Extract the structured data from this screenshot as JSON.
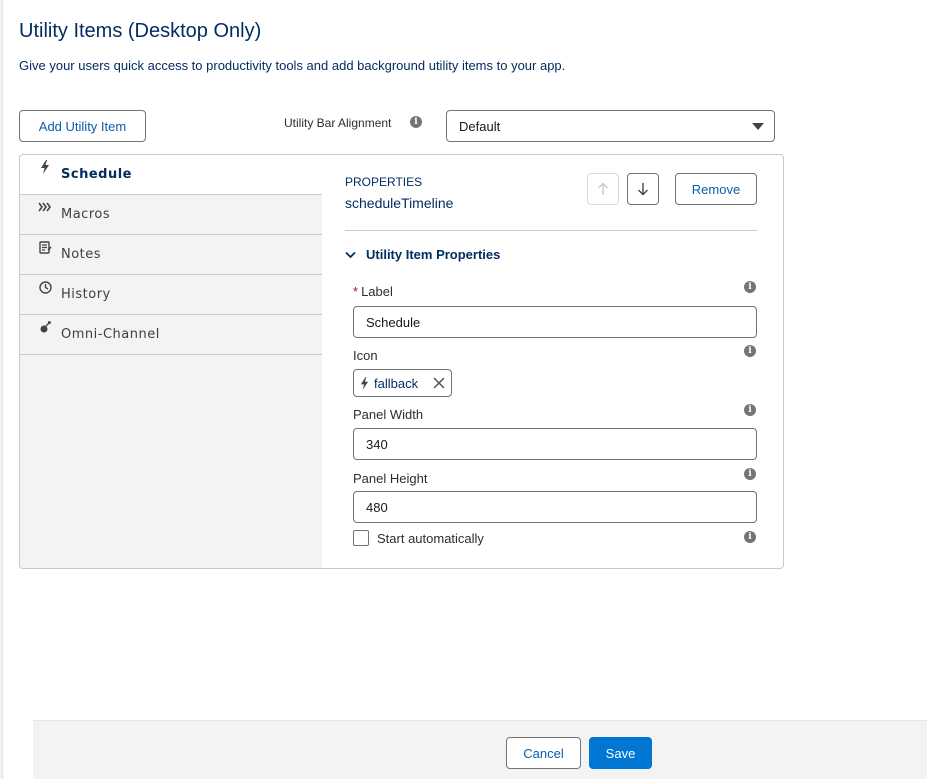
{
  "page": {
    "title": "Utility Items (Desktop Only)",
    "description": "Give your users quick access to productivity tools and add background utility items to your app."
  },
  "toolbar": {
    "add_label": "Add Utility Item",
    "alignment_label": "Utility Bar Alignment",
    "alignment_value": "Default"
  },
  "sidebar": {
    "items": [
      {
        "label": "Schedule",
        "icon": "lightning-icon",
        "active": true
      },
      {
        "label": "Macros",
        "icon": "macros-icon",
        "active": false
      },
      {
        "label": "Notes",
        "icon": "notes-icon",
        "active": false
      },
      {
        "label": "History",
        "icon": "clock-icon",
        "active": false
      },
      {
        "label": "Omni-Channel",
        "icon": "omni-channel-icon",
        "active": false
      }
    ]
  },
  "properties": {
    "caps_label": "PROPERTIES",
    "component_name": "scheduleTimeline",
    "remove_label": "Remove",
    "section_title": "Utility Item Properties",
    "label_field": {
      "label": "Label",
      "value": "Schedule",
      "required": true
    },
    "icon_field": {
      "label": "Icon",
      "value": "fallback"
    },
    "width_field": {
      "label": "Panel Width",
      "value": "340"
    },
    "height_field": {
      "label": "Panel Height",
      "value": "480"
    },
    "autostart": {
      "label": "Start automatically",
      "checked": false
    }
  },
  "footer": {
    "cancel_label": "Cancel",
    "save_label": "Save"
  },
  "colors": {
    "brand": "#0176d3",
    "title": "#032d60",
    "link": "#0b5cab",
    "required": "#ba0517"
  }
}
